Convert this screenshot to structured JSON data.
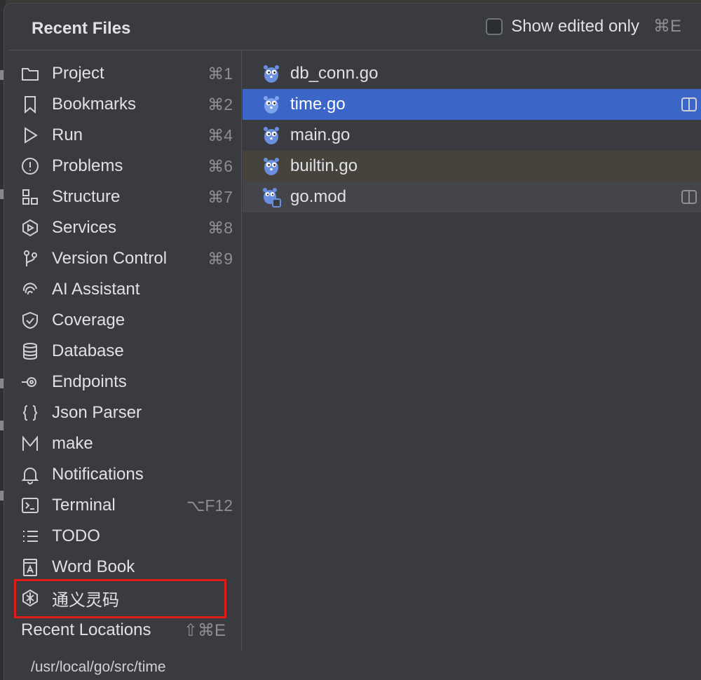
{
  "popup": {
    "title": "Recent Files",
    "show_edited_label": "Show edited only",
    "show_edited_shortcut": "⌘E",
    "show_edited_checked": false
  },
  "tool_windows": [
    {
      "label": "Project",
      "shortcut": "⌘1",
      "icon": "folder-icon"
    },
    {
      "label": "Bookmarks",
      "shortcut": "⌘2",
      "icon": "bookmark-icon"
    },
    {
      "label": "Run",
      "shortcut": "⌘4",
      "icon": "run-icon"
    },
    {
      "label": "Problems",
      "shortcut": "⌘6",
      "icon": "problems-icon"
    },
    {
      "label": "Structure",
      "shortcut": "⌘7",
      "icon": "structure-icon"
    },
    {
      "label": "Services",
      "shortcut": "⌘8",
      "icon": "services-icon"
    },
    {
      "label": "Version Control",
      "shortcut": "⌘9",
      "icon": "vcs-branch-icon"
    },
    {
      "label": "AI Assistant",
      "shortcut": "",
      "icon": "ai-assistant-icon"
    },
    {
      "label": "Coverage",
      "shortcut": "",
      "icon": "shield-icon"
    },
    {
      "label": "Database",
      "shortcut": "",
      "icon": "database-icon"
    },
    {
      "label": "Endpoints",
      "shortcut": "",
      "icon": "endpoints-icon"
    },
    {
      "label": "Json Parser",
      "shortcut": "",
      "icon": "braces-icon"
    },
    {
      "label": "make",
      "shortcut": "",
      "icon": "make-icon"
    },
    {
      "label": "Notifications",
      "shortcut": "",
      "icon": "bell-icon"
    },
    {
      "label": "Terminal",
      "shortcut": "⌥F12",
      "icon": "terminal-icon"
    },
    {
      "label": "TODO",
      "shortcut": "",
      "icon": "todo-list-icon"
    },
    {
      "label": "Word Book",
      "shortcut": "",
      "icon": "word-book-icon"
    },
    {
      "label": "通义灵码",
      "shortcut": "",
      "icon": "tongyi-lingma-icon"
    }
  ],
  "recent_locations": {
    "label": "Recent Locations",
    "shortcut": "⇧⌘E"
  },
  "files": [
    {
      "name": "db_conn.go",
      "icon": "gopher-icon",
      "state": "normal",
      "split_icon": false
    },
    {
      "name": "time.go",
      "icon": "gopher-icon",
      "state": "selected",
      "split_icon": true
    },
    {
      "name": "main.go",
      "icon": "gopher-icon",
      "state": "normal",
      "split_icon": false
    },
    {
      "name": "builtin.go",
      "icon": "gopher-icon",
      "state": "modified",
      "split_icon": false
    },
    {
      "name": "go.mod",
      "icon": "gopher-mod-icon",
      "state": "hover",
      "split_icon": true
    }
  ],
  "footer": {
    "path": "/usr/local/go/src/time"
  },
  "colors": {
    "selection": "#3b65c6",
    "highlight_box": "#e01b1b",
    "background": "#393b40"
  }
}
